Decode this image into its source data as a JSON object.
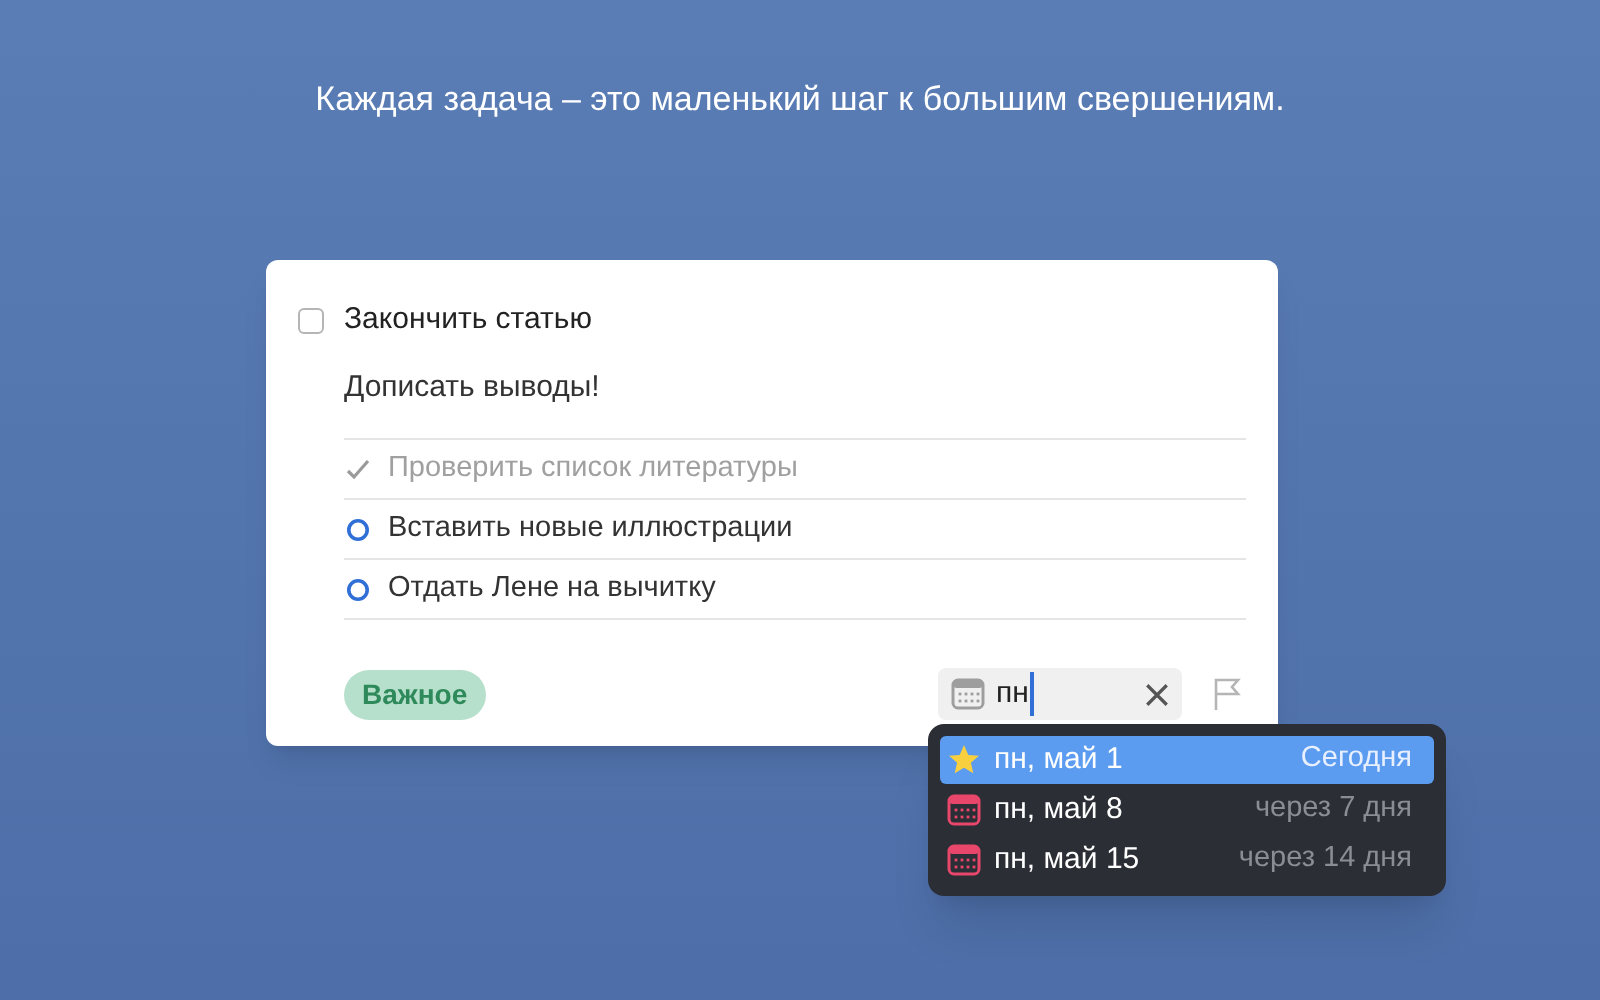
{
  "headline": "Каждая задача – это маленький шаг к большим свершениям.",
  "task": {
    "title": "Закончить статью",
    "checked": false,
    "notes": "Дописать выводы!",
    "checklist": [
      {
        "text": "Проверить список литературы",
        "checked": true
      },
      {
        "text": "Вставить новые иллюстрации",
        "checked": false
      },
      {
        "text": "Отдать Лене на вычитку",
        "checked": false
      }
    ],
    "tag": "Важное",
    "date_field": {
      "value": "пн"
    }
  },
  "suggestions": [
    {
      "kind": "today",
      "label": "пн, май 1",
      "hint": "Сегодня",
      "selected": true
    },
    {
      "kind": "date",
      "label": "пн, май 8",
      "hint": "через 7 дня",
      "selected": false
    },
    {
      "kind": "date",
      "label": "пн, май 15",
      "hint": "через 14 дня",
      "selected": false
    }
  ]
}
